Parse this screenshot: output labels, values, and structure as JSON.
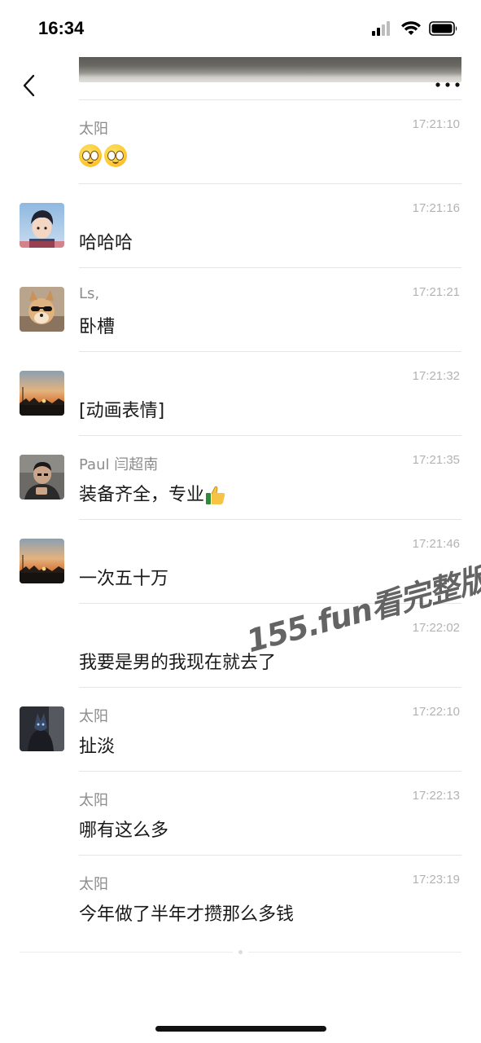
{
  "status_bar": {
    "time": "16:34"
  },
  "nav": {
    "back_icon": "chevron-left-icon",
    "more_icon": "more-horizontal-icon"
  },
  "messages": [
    {
      "sender": "太阳",
      "time": "17:21:10",
      "text": "",
      "emoji": "two-flushed-emoji",
      "avatar": "none"
    },
    {
      "sender": "",
      "time": "17:21:16",
      "text": "哈哈哈",
      "avatar": "anime-boy-avatar"
    },
    {
      "sender": "Ls,",
      "time": "17:21:21",
      "text": "卧槽",
      "avatar": "dog-sunglasses-avatar"
    },
    {
      "sender": "",
      "time": "17:21:32",
      "text": "[动画表情]",
      "avatar": "sunset-avatar"
    },
    {
      "sender": "Paul  闫超南",
      "time": "17:21:35",
      "text": "装备齐全，专业",
      "emoji": "thumbs-up-emoji",
      "avatar": "man-phone-avatar"
    },
    {
      "sender": "",
      "time": "17:21:46",
      "text": "一次五十万",
      "avatar": "sunset-avatar"
    },
    {
      "sender": "",
      "time": "17:22:02",
      "text": "我要是男的我现在就去了",
      "avatar": "none"
    },
    {
      "sender": "太阳",
      "time": "17:22:10",
      "text": "扯淡",
      "avatar": "dark-figure-avatar"
    },
    {
      "sender": "太阳",
      "time": "17:22:13",
      "text": "哪有这么多",
      "avatar": "none"
    },
    {
      "sender": "太阳",
      "time": "17:23:19",
      "text": "今年做了半年才攒那么多钱",
      "avatar": "none"
    }
  ],
  "watermark": "155.fun看完整版",
  "colors": {
    "background": "#ffffff",
    "timestamp": "#b3b3b3",
    "sender": "#8c8c8c",
    "divider": "#e6e6e6"
  }
}
